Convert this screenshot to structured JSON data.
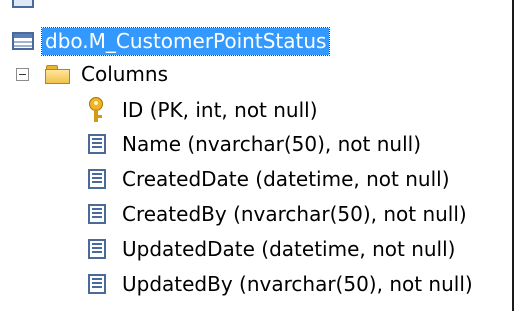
{
  "tree": {
    "table_name": "dbo.M_CustomerPointStatus",
    "folder_label": "Columns",
    "columns": [
      {
        "label": "ID (PK, int, not null)",
        "icon": "primary-key-icon"
      },
      {
        "label": "Name (nvarchar(50), not null)",
        "icon": "column-icon"
      },
      {
        "label": "CreatedDate (datetime, not null)",
        "icon": "column-icon"
      },
      {
        "label": "CreatedBy (nvarchar(50), not null)",
        "icon": "column-icon"
      },
      {
        "label": "UpdatedDate (datetime, not null)",
        "icon": "column-icon"
      },
      {
        "label": "UpdatedBy (nvarchar(50), not null)",
        "icon": "column-icon"
      }
    ]
  },
  "colors": {
    "selection_bg": "#3399ff",
    "selection_text": "#ffffff",
    "folder": "#f2c24c",
    "key": "#f0b428",
    "icon_stroke": "#4a6a9c"
  }
}
